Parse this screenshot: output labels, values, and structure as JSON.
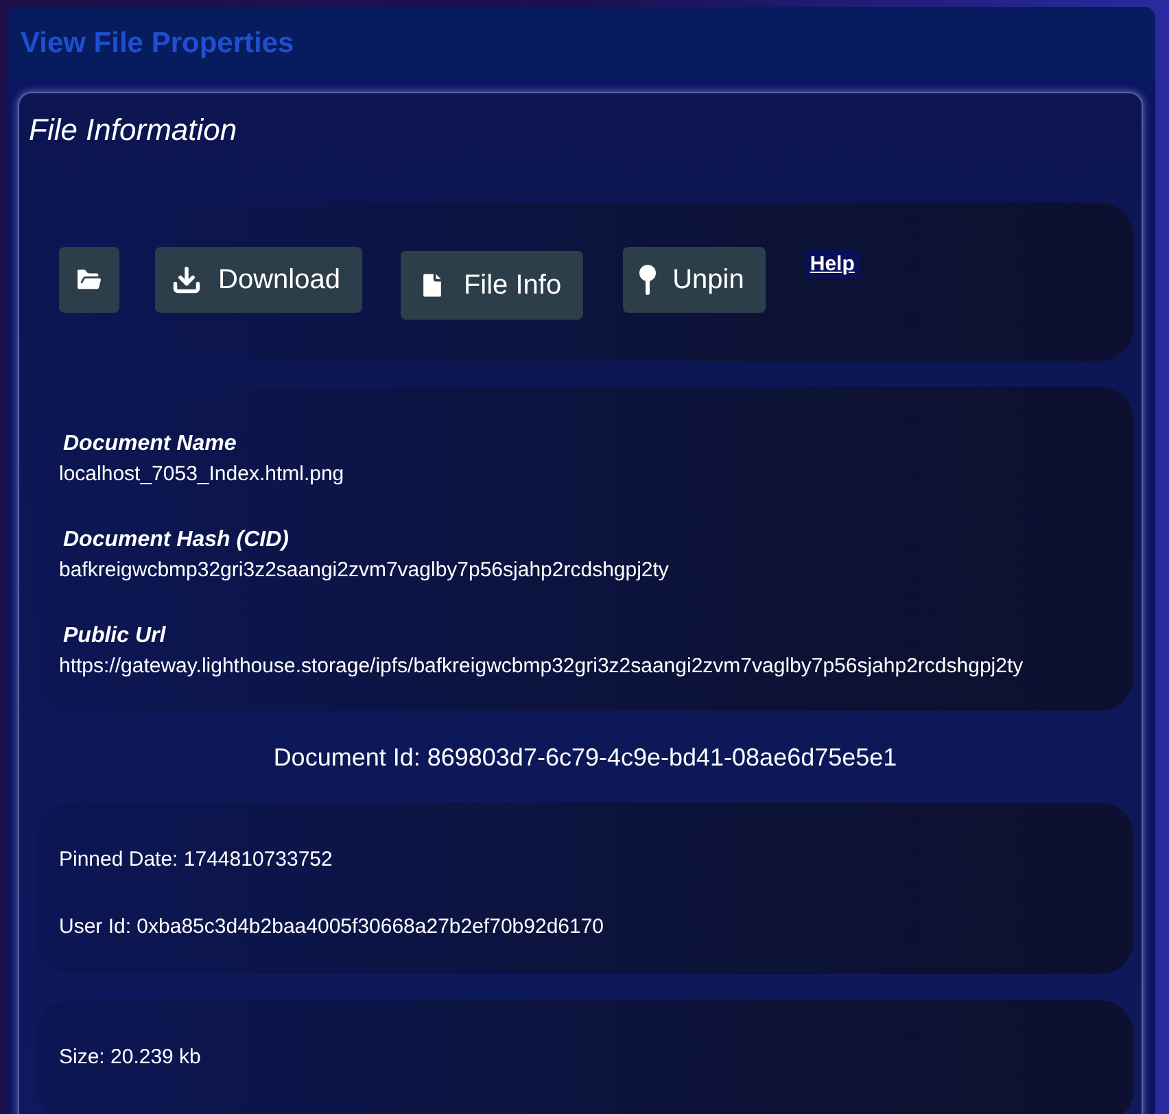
{
  "header": {
    "title": "View File Properties"
  },
  "card": {
    "title": "File Information"
  },
  "toolbar": {
    "buttons": [
      {
        "kind": "folder"
      },
      {
        "kind": "download",
        "label": "Download"
      },
      {
        "kind": "file",
        "label": "File Info"
      },
      {
        "kind": "pin",
        "label": "Unpin"
      }
    ],
    "help": "Help"
  },
  "details": [
    {
      "label": "Document Name",
      "value": "localhost_7053_Index.html.png"
    },
    {
      "label": "Document Hash (CID)",
      "value": "bafkreigwcbmp32gri3z2saangi2zvm7vaglby7p56sjahp2rcdshgpj2ty"
    },
    {
      "label": "Public Url",
      "value": "https://gateway.lighthouse.storage/ipfs/bafkreigwcbmp32gri3z2saangi2zvm7vaglby7p56sjahp2rcdshgpj2ty"
    }
  ],
  "document_id": "Document Id: 869803d7-6c79-4c9e-bd41-08ae6d75e5e1",
  "pin_info": [
    "Pinned Date: 1744810733752",
    "User Id: 0xba85c3d4b2baa4005f30668a27b2ef70b92d6170"
  ],
  "size_info": [
    "Size: 20.239 kb"
  ]
}
